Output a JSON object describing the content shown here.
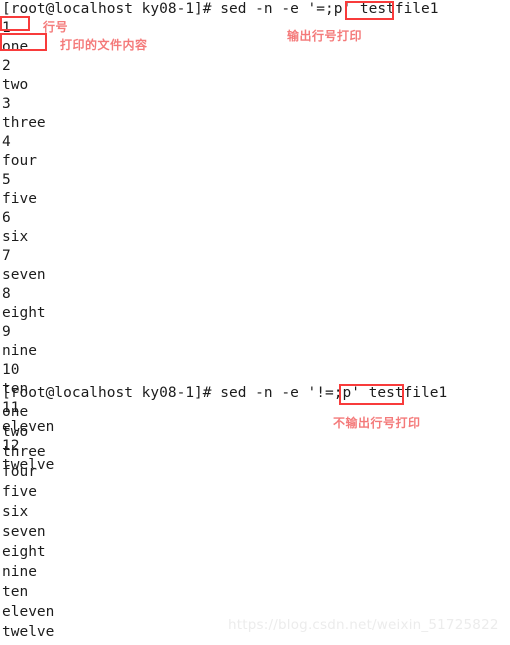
{
  "terminal": {
    "prompt": "[root@localhost ky08-1]#",
    "blocks": [
      {
        "command_line": "[root@localhost ky08-1]# sed -n -e '=;p' testfile1",
        "command": "sed -n -e '=;p' testfile1",
        "highlight_text": "'=;p'",
        "output": [
          "1",
          "one",
          "2",
          "two",
          "3",
          "three",
          "4",
          "four",
          "5",
          "five",
          "6",
          "six",
          "7",
          "seven",
          "8",
          "eight",
          "9",
          "nine",
          "10",
          "ten",
          "11",
          "eleven",
          "12",
          "twelve"
        ]
      },
      {
        "command_line": "[root@localhost ky08-1]# sed -n -e '!=;p' testfile1",
        "command": "sed -n -e '!=;p' testfile1",
        "highlight_text": "'!=;p'",
        "output": [
          "one",
          "two",
          "three",
          "four",
          "five",
          "six",
          "seven",
          "eight",
          "nine",
          "ten",
          "eleven",
          "twelve"
        ]
      }
    ]
  },
  "annotations": {
    "line_number_label": "行号",
    "file_content_label": "打印的文件内容",
    "print_with_linenumber_label": "输出行号打印",
    "print_without_linenumber_label": "不输出行号打印"
  },
  "watermark": {
    "text": "https://blog.csdn.net/weixin_51725822"
  },
  "colors": {
    "highlight_border": "#f83b3b",
    "annotation_text": "#f47a7a",
    "terminal_text": "#1c1c1c",
    "background": "#ffffff",
    "watermark_text": "#ececec"
  }
}
